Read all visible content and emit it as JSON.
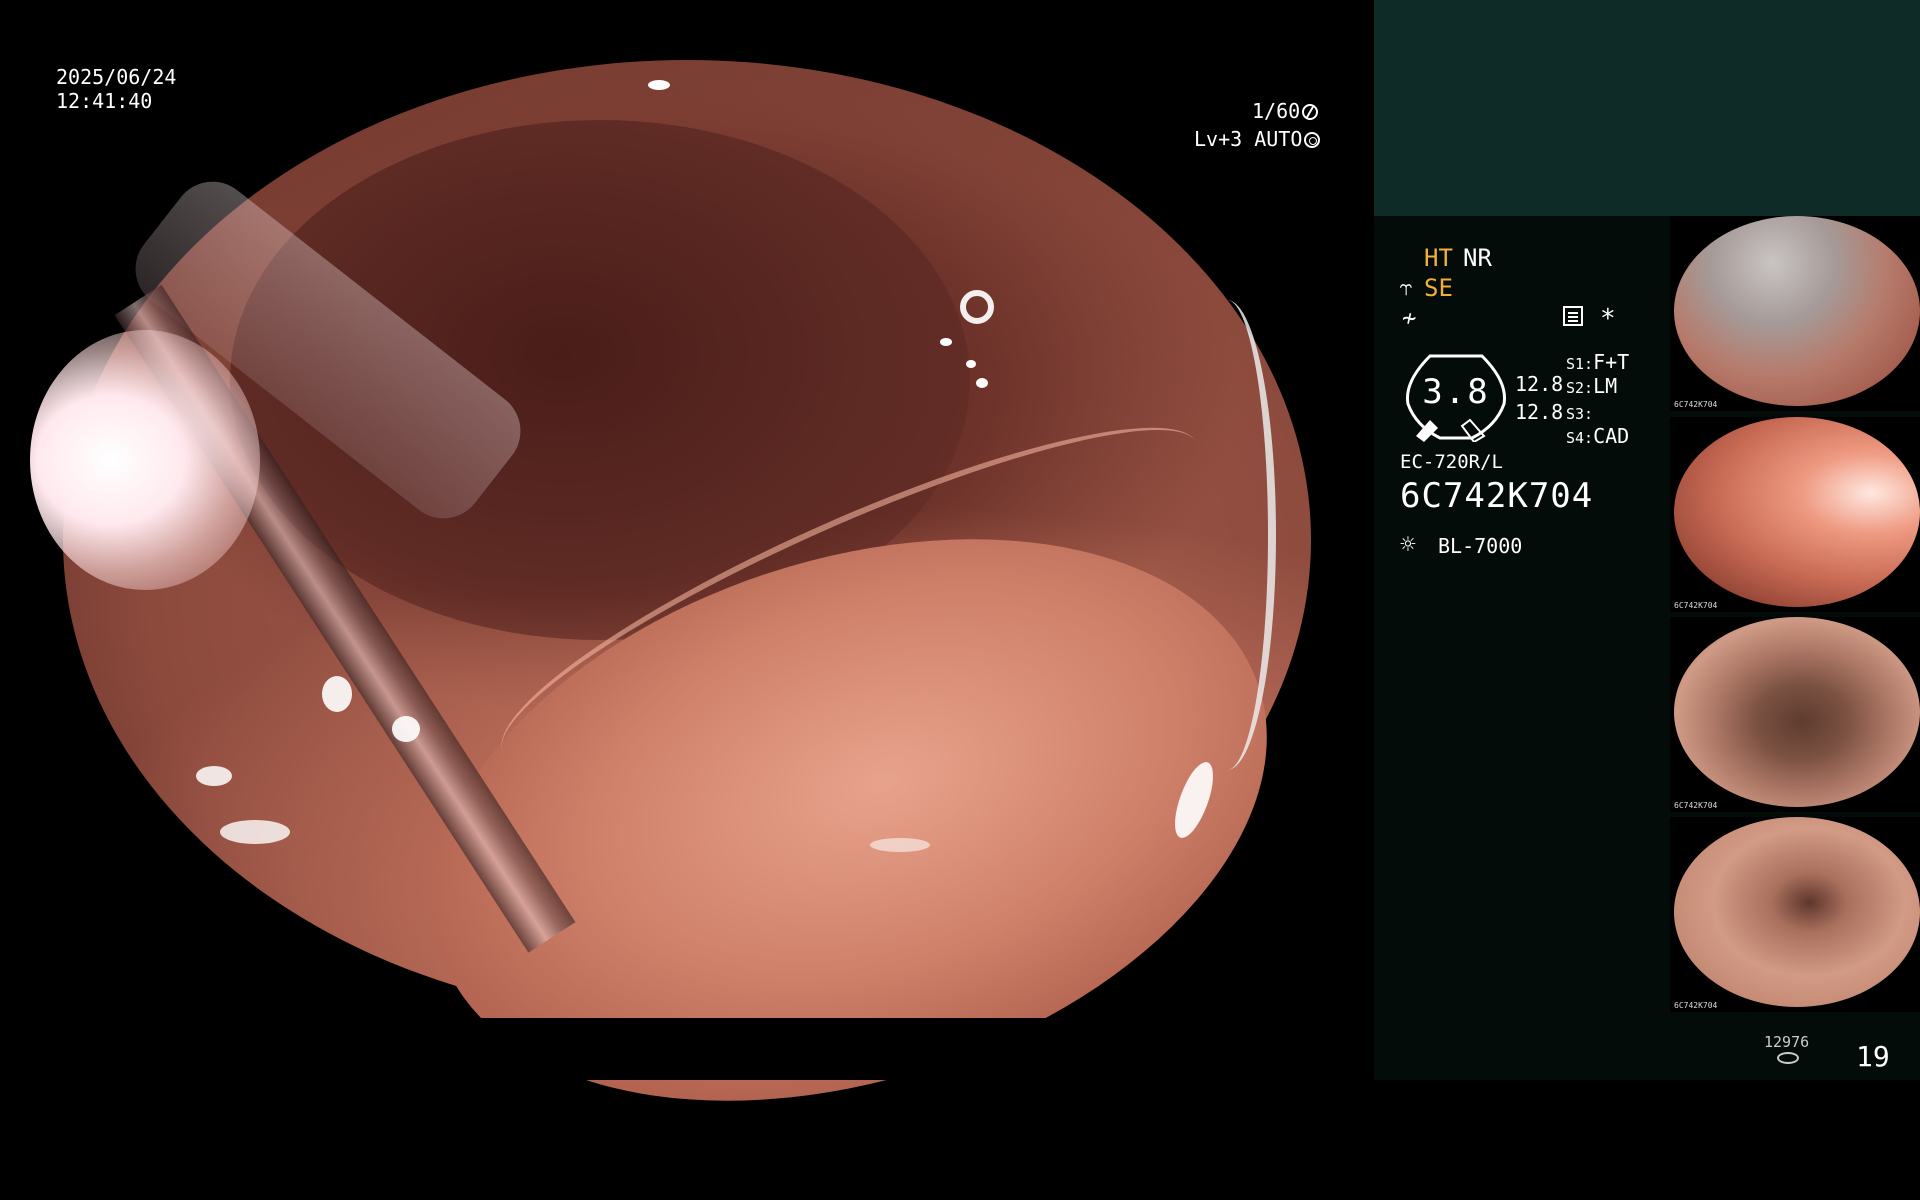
{
  "overlay": {
    "date": "2025/06/24",
    "time": "12:41:40",
    "shutter": "1/60",
    "level": "Lv+3 AUTO"
  },
  "panel": {
    "ht": "HT",
    "nr": "NR",
    "se": "SE",
    "gauge_value": "3.8",
    "gauge_values": [
      "12.8",
      "12.8"
    ],
    "switches": [
      {
        "key": "S1:",
        "value": "F+T"
      },
      {
        "key": "S2:",
        "value": "LM"
      },
      {
        "key": "S3:",
        "value": ""
      },
      {
        "key": "S4:",
        "value": "CAD"
      }
    ],
    "scope_model": "EC-720R/L",
    "scope_serial": "6C742K704",
    "light_source": "BL-7000"
  },
  "thumbnails": [
    {
      "serial": "6C742K704"
    },
    {
      "serial": "6C742K704"
    },
    {
      "serial": "6C742K704"
    },
    {
      "serial": "6C742K704"
    }
  ],
  "footer": {
    "count": "12976",
    "number": "19"
  },
  "icons": {
    "shutter": "aperture-icon",
    "level": "auto-iris-icon",
    "se": "structure-enhance-icon",
    "filter": "filter-icon",
    "settings": "settings-icon",
    "asterisk": "asterisk-icon",
    "light": "light-source-icon",
    "disk": "disk-icon"
  },
  "colors": {
    "accent": "#f2b134",
    "panel_top": "#0e2b27",
    "panel_bg": "#040c0a"
  }
}
